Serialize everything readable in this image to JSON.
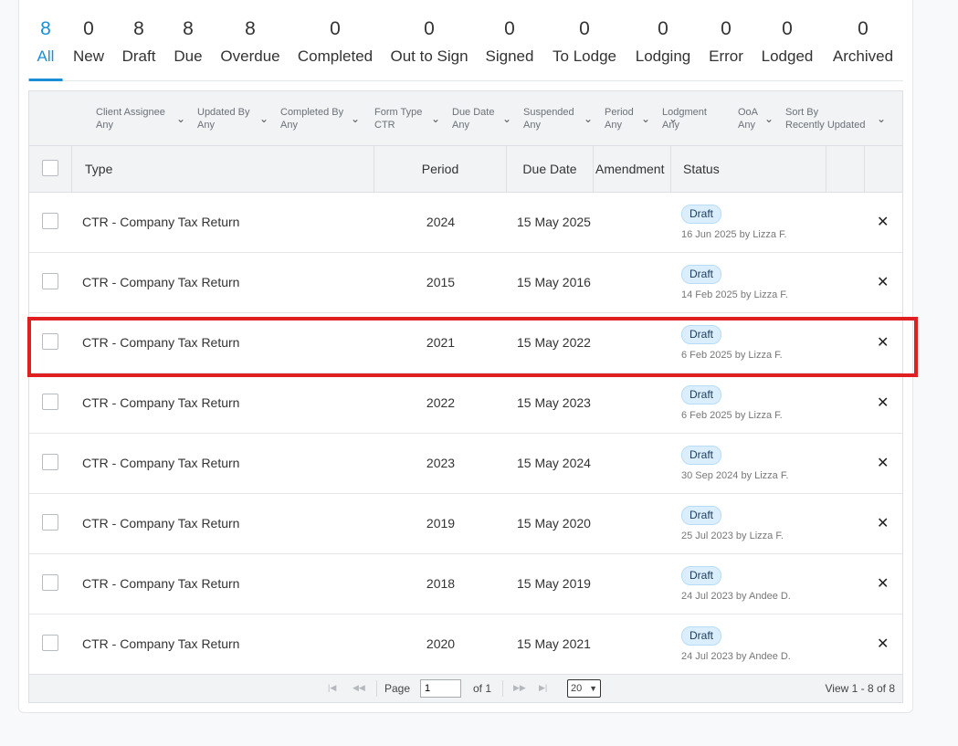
{
  "tabs": [
    {
      "count": "8",
      "label": "All",
      "active": true
    },
    {
      "count": "0",
      "label": "New"
    },
    {
      "count": "8",
      "label": "Draft"
    },
    {
      "count": "8",
      "label": "Due"
    },
    {
      "count": "8",
      "label": "Overdue"
    },
    {
      "count": "0",
      "label": "Completed"
    },
    {
      "count": "0",
      "label": "Out to Sign"
    },
    {
      "count": "0",
      "label": "Signed"
    },
    {
      "count": "0",
      "label": "To Lodge"
    },
    {
      "count": "0",
      "label": "Lodging"
    },
    {
      "count": "0",
      "label": "Error"
    },
    {
      "count": "0",
      "label": "Lodged"
    },
    {
      "count": "0",
      "label": "Archived"
    }
  ],
  "filters": [
    {
      "label": "Client Assignee",
      "value": "Any"
    },
    {
      "label": "Updated By",
      "value": "Any"
    },
    {
      "label": "Completed By",
      "value": "Any"
    },
    {
      "label": "Form Type",
      "value": "CTR"
    },
    {
      "label": "Due Date",
      "value": "Any"
    },
    {
      "label": "Suspended",
      "value": "Any"
    },
    {
      "label": "Period",
      "value": "Any"
    },
    {
      "label": "Lodgment",
      "value": "Any"
    },
    {
      "label": "OoA",
      "value": "Any"
    },
    {
      "label": "Sort By",
      "value": "Recently Updated"
    }
  ],
  "columns": {
    "type": "Type",
    "period": "Period",
    "due_date": "Due Date",
    "amendment": "Amendment",
    "status": "Status"
  },
  "rows": [
    {
      "type": "CTR - Company Tax Return",
      "period": "2024",
      "due": "15 May 2025",
      "status": "Draft",
      "updated": "16 Jun 2025 by Lizza F."
    },
    {
      "type": "CTR - Company Tax Return",
      "period": "2015",
      "due": "15 May 2016",
      "status": "Draft",
      "updated": "14 Feb 2025 by Lizza F."
    },
    {
      "type": "CTR - Company Tax Return",
      "period": "2021",
      "due": "15 May 2022",
      "status": "Draft",
      "updated": "6 Feb 2025 by Lizza F."
    },
    {
      "type": "CTR - Company Tax Return",
      "period": "2022",
      "due": "15 May 2023",
      "status": "Draft",
      "updated": "6 Feb 2025 by Lizza F."
    },
    {
      "type": "CTR - Company Tax Return",
      "period": "2023",
      "due": "15 May 2024",
      "status": "Draft",
      "updated": "30 Sep 2024 by Lizza F."
    },
    {
      "type": "CTR - Company Tax Return",
      "period": "2019",
      "due": "15 May 2020",
      "status": "Draft",
      "updated": "25 Jul 2023 by Lizza F."
    },
    {
      "type": "CTR - Company Tax Return",
      "period": "2018",
      "due": "15 May 2019",
      "status": "Draft",
      "updated": "24 Jul 2023 by Andee D."
    },
    {
      "type": "CTR - Company Tax Return",
      "period": "2020",
      "due": "15 May 2021",
      "status": "Draft",
      "updated": "24 Jul 2023 by Andee D."
    }
  ],
  "pager": {
    "page_label": "Page",
    "page_value": "1",
    "of_label": "of 1",
    "page_size": "20",
    "view_text": "View 1 - 8 of 8",
    "first_icon": "first-page-icon",
    "prev_icon": "prev-page-icon",
    "next_icon": "next-page-icon",
    "last_icon": "last-page-icon"
  },
  "colors": {
    "accent": "#1a8fd8",
    "highlight": "#e02020",
    "badge_bg": "#dbeefd"
  }
}
